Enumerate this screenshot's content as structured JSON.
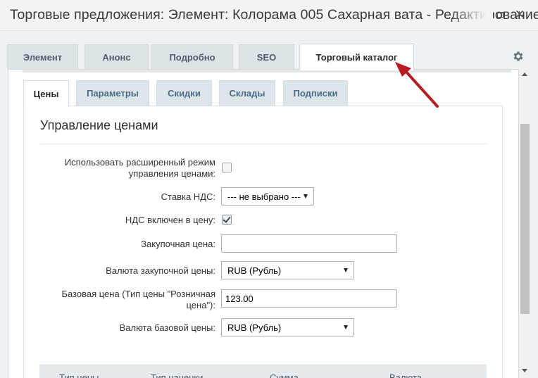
{
  "window": {
    "title": "Торговые предложения: Элемент: Колорама 005 Сахарная вата - Редактирование"
  },
  "main_tabs": [
    {
      "label": "Элемент",
      "active": false
    },
    {
      "label": "Анонс",
      "active": false
    },
    {
      "label": "Подробно",
      "active": false
    },
    {
      "label": "SEO",
      "active": false
    },
    {
      "label": "Торговый каталог",
      "active": true
    }
  ],
  "sub_tabs": [
    {
      "label": "Цены",
      "active": true
    },
    {
      "label": "Параметры",
      "active": false
    },
    {
      "label": "Скидки",
      "active": false
    },
    {
      "label": "Склады",
      "active": false
    },
    {
      "label": "Подписки",
      "active": false
    }
  ],
  "section": {
    "title": "Управление ценами"
  },
  "form": {
    "extended_mode_label_line1": "Использовать расширенный режим",
    "extended_mode_label_line2": "управления ценами:",
    "extended_mode_checked": false,
    "vat_rate_label": "Ставка НДС:",
    "vat_rate_value": "--- не выбрано ---",
    "vat_included_label": "НДС включен в цену:",
    "vat_included_checked": true,
    "purchase_price_label": "Закупочная цена:",
    "purchase_price_value": "",
    "purchase_currency_label": "Валюта закупочной цены:",
    "purchase_currency_value": "RUB (Рубль)",
    "base_price_label_line1": "Базовая цена (Тип цены \"Розничная",
    "base_price_label_line2": "цена\"):",
    "base_price_value": "123.00",
    "base_currency_label": "Валюта базовой цены:",
    "base_currency_value": "RUB (Рубль)"
  },
  "price_table": {
    "headers": [
      "Тип цены",
      "Тип наценки",
      "Сумма",
      "Валюта"
    ]
  },
  "colors": {
    "annotation_arrow": "#b81c22",
    "tab_bg": "#dde4e8",
    "sub_tab_text": "#4a6b86"
  },
  "icons": {
    "settings": "gear-icon",
    "maximize": "maximize-icon",
    "close": "close-icon"
  }
}
